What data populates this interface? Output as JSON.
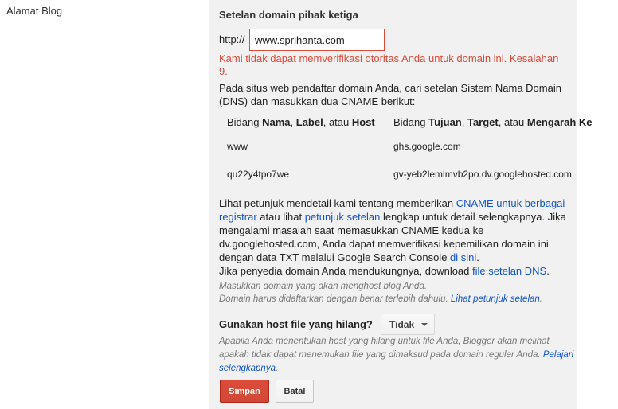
{
  "left": {
    "label": "Alamat Blog"
  },
  "section": {
    "title": "Setelan domain pihak ketiga",
    "http_label": "http://",
    "domain_value": "www.sprihanta.com",
    "error": "Kami tidak dapat memverifikasi otoritas Anda untuk domain ini. Kesalahan 9.",
    "description": "Pada situs web pendaftar domain Anda, cari setelan Sistem Nama Domain (DNS) dan masukkan dua CNAME berikut:"
  },
  "cname_table": {
    "header_left": {
      "prefix": "Bidang ",
      "b1": "Nama",
      "sep1": ", ",
      "b2": "Label",
      "sep2": ", atau ",
      "b3": "Host"
    },
    "header_right": {
      "prefix": "Bidang ",
      "b1": "Tujuan",
      "sep1": ", ",
      "b2": "Target",
      "sep2": ", atau ",
      "b3": "Mengarah Ke"
    },
    "rows": [
      {
        "name": "www",
        "target": "ghs.google.com"
      },
      {
        "name": "qu22y4tpo7we",
        "target": "gv-yeb2lemlmvb2po.dv.googlehosted.com"
      }
    ]
  },
  "info": {
    "t1": "Lihat petunjuk mendetail kami tentang memberikan ",
    "link1": "CNAME untuk berbagai registrar",
    "t2": " atau lihat ",
    "link2": "petunjuk setelan",
    "t3": " lengkap untuk detail selengkapnya. Jika mengalami masalah saat memasukkan CNAME kedua ke dv.googlehosted.com, Anda dapat memverifikasi kepemilikan domain ini dengan data TXT melalui Google Search Console ",
    "link3": "di sini",
    "t4": ".",
    "t5": "Jika penyedia domain Anda mendukungnya, download ",
    "link4": "file setelan DNS",
    "t6": "."
  },
  "hint": {
    "line1": "Masukkan domain yang akan menghost blog Anda.",
    "line2": "Domain harus didaftarkan dengan benar terlebih dahulu. ",
    "link": "Lihat petunjuk setelan",
    "end": "."
  },
  "missing_files": {
    "label": "Gunakan host file yang hilang?",
    "selected": "Tidak",
    "help": "Apabila Anda menentukan host yang hilang untuk file Anda, Blogger akan melihat apakah tidak dapat menemukan file yang dimaksud pada domain reguler Anda. ",
    "link": "Pelajari selengkapnya",
    "end": "."
  },
  "actions": {
    "save": "Simpan",
    "cancel": "Batal"
  },
  "colors": {
    "accent_red": "#dd4b39",
    "link_blue": "#15c",
    "panel_bg": "#f1f1f1"
  }
}
